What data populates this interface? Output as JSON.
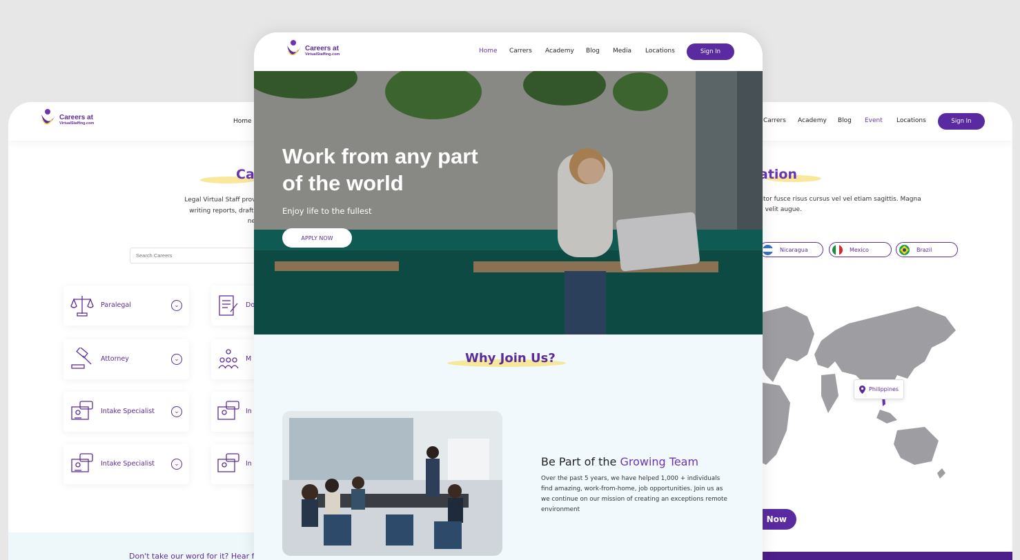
{
  "logo": {
    "main": "Careers at",
    "sub": "VirtualStaffing.com"
  },
  "left_page": {
    "nav": {
      "home": "Home"
    },
    "title": "Ca",
    "paragraph_lines": [
      "Legal Virtual Staff provides lawyers assistance",
      "writing reports, drafting contracts, collectin",
      "neces"
    ],
    "search_placeholder": "Search Careers",
    "careers": [
      {
        "label": "Paralegal",
        "icon": "scales-icon"
      },
      {
        "label": "Attorney",
        "icon": "gavel-icon"
      },
      {
        "label": "Intake Specialist",
        "icon": "computer-chat-icon"
      },
      {
        "label": "Intake Specialist",
        "icon": "computer-chat-icon"
      }
    ],
    "careers_col2": [
      "Do",
      "M",
      "In",
      "In"
    ],
    "testimonial": "Don't take our word for it? Hear fro"
  },
  "center_page": {
    "nav": {
      "home": "Home",
      "carrers": "Carrers",
      "academy": "Academy",
      "blog": "Blog",
      "media": "Media",
      "locations": "Locations",
      "signin": "Sign In"
    },
    "hero": {
      "title": "Work from any part of the world",
      "subtitle": "Enjoy life to the fullest",
      "cta": "APPLY NOW"
    },
    "why_title": "Why Join Us?",
    "be_part": {
      "prefix": "Be Part of the ",
      "highlight": "Growing Team",
      "description": "Over the past 5 years, we have helped 1,000 + individuals find amazing, work-from-home, job opportunities. Join us as we continue on our mission of creating an exceptions remote environment"
    }
  },
  "right_page": {
    "nav": {
      "carrers": "Carrers",
      "academy": "Academy",
      "blog": "Blog",
      "event": "Event",
      "locations": "Locations",
      "signin": "Sign In"
    },
    "title": "ation",
    "paragraph_lines": [
      "titor fusce risus cursus vel vel etiam sagittis. Magna",
      "n velit augue."
    ],
    "countries": [
      "Nicaragua",
      "Mexico",
      "Brazil"
    ],
    "map_pin": "Philippines",
    "cta": "Now"
  },
  "colors": {
    "brand": "#5a2aa0",
    "accent_text": "#6a35b3",
    "highlight": "#f8e48a",
    "band": "#f1f9fc"
  }
}
